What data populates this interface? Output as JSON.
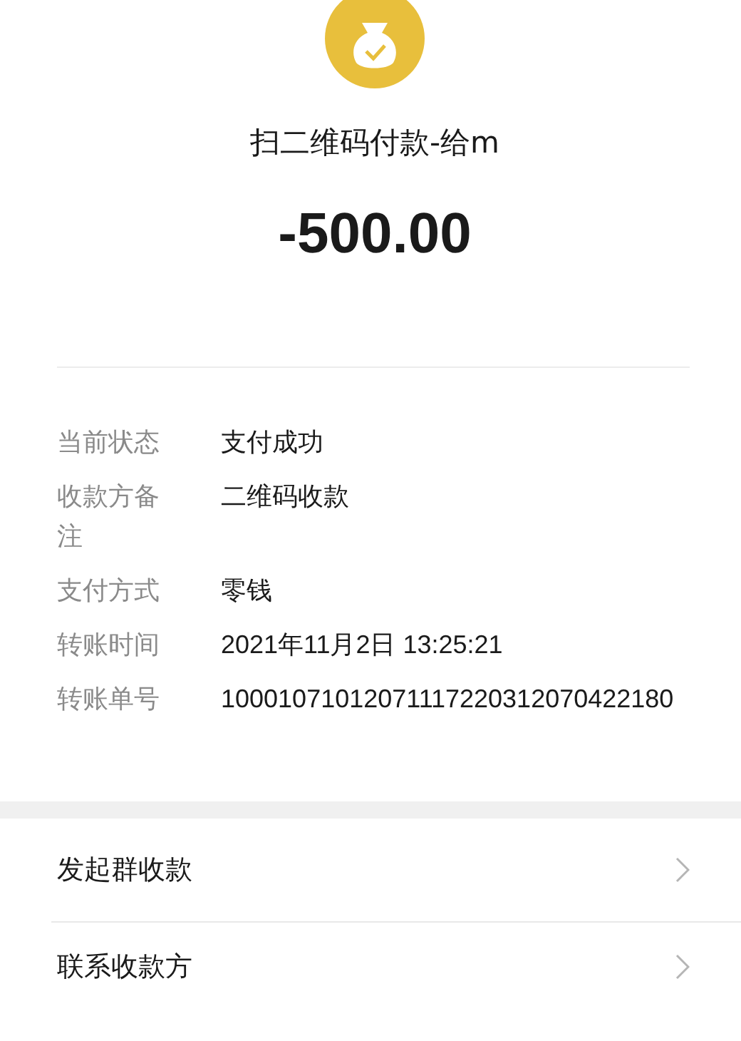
{
  "title": "扫二维码付款-给m",
  "amount": "-500.00",
  "details": [
    {
      "label": "当前状态",
      "value": "支付成功"
    },
    {
      "label": "收款方备注",
      "value": "二维码收款"
    },
    {
      "label": "支付方式",
      "value": "零钱"
    },
    {
      "label": "转账时间",
      "value": "2021年11月2日 13:25:21"
    },
    {
      "label": "转账单号",
      "value": "10001071012071117220312070422180"
    }
  ],
  "actions": [
    {
      "label": "发起群收款"
    },
    {
      "label": "联系收款方"
    }
  ]
}
